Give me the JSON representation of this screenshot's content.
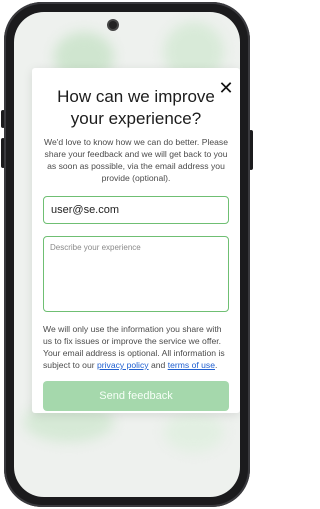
{
  "modal": {
    "title": "How can we improve your experience?",
    "intro": "We'd love to know how we can do better. Please share your feedback and we will get back to you as soon as possible, via the email address you provide (optional).",
    "email_value": "user@se.com",
    "description_placeholder": "Describe your experience",
    "disclaimer": {
      "text_before": "We will only use the information you share with us to fix issues or improve the service we offer. Your email address is optional. All information is subject to our ",
      "privacy_link": "privacy policy",
      "and": " and ",
      "terms_link": "terms of use",
      "period": "."
    },
    "send_label": "Send feedback",
    "close_label": "✕"
  },
  "colors": {
    "accent_border": "#6fbf73",
    "button_disabled": "#a5d8ac",
    "link": "#1f5fd0"
  }
}
